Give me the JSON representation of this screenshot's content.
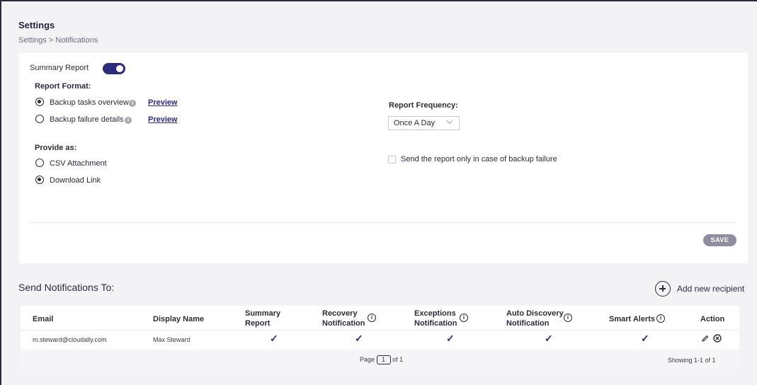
{
  "header": {
    "title": "Settings",
    "breadcrumb": "Settings > Notifications"
  },
  "summary": {
    "label": "Summary Report",
    "enabled": true,
    "report_format_label": "Report Format:",
    "formats": [
      {
        "label": "Backup tasks overview",
        "selected": true,
        "preview": "Preview"
      },
      {
        "label": "Backup failure details",
        "selected": false,
        "preview": "Preview"
      }
    ],
    "frequency_label": "Report Frequency:",
    "frequency_value": "Once A Day",
    "provide_label": "Provide as:",
    "provide_options": [
      {
        "label": "CSV Attachment",
        "selected": false
      },
      {
        "label": "Download Link",
        "selected": true
      }
    ],
    "failure_only_label": "Send the report only in case of backup failure",
    "failure_only_checked": false,
    "save_label": "SAVE"
  },
  "recipients": {
    "title": "Send Notifications To:",
    "add_label": "Add new recipient",
    "columns": {
      "email": "Email",
      "display_name": "Display Name",
      "summary": [
        "Summary",
        "Report"
      ],
      "recovery": [
        "Recovery",
        "Notification"
      ],
      "exceptions": [
        "Exceptions",
        "Notification"
      ],
      "auto_discovery": [
        "Auto Discovery",
        "Notification"
      ],
      "smart_alerts": "Smart Alerts",
      "action": "Action"
    },
    "info_glyph": "i",
    "rows": [
      {
        "email": "m.steward@cloudally.com",
        "display_name": "Max Steward",
        "summary": true,
        "recovery": true,
        "exceptions": true,
        "auto_discovery": true,
        "smart_alerts": true
      }
    ],
    "check_glyph": "✓",
    "edit_icon": "pencil-icon",
    "delete_icon": "close-circle-icon",
    "pagination": {
      "page_label": "Page",
      "page": "1",
      "of_label": "of 1"
    },
    "showing": "Showing 1-1 of 1"
  },
  "colors": {
    "accent": "#2c2c7a",
    "save_disabled": "#8e8ea0",
    "text": "#2b2b3a"
  }
}
